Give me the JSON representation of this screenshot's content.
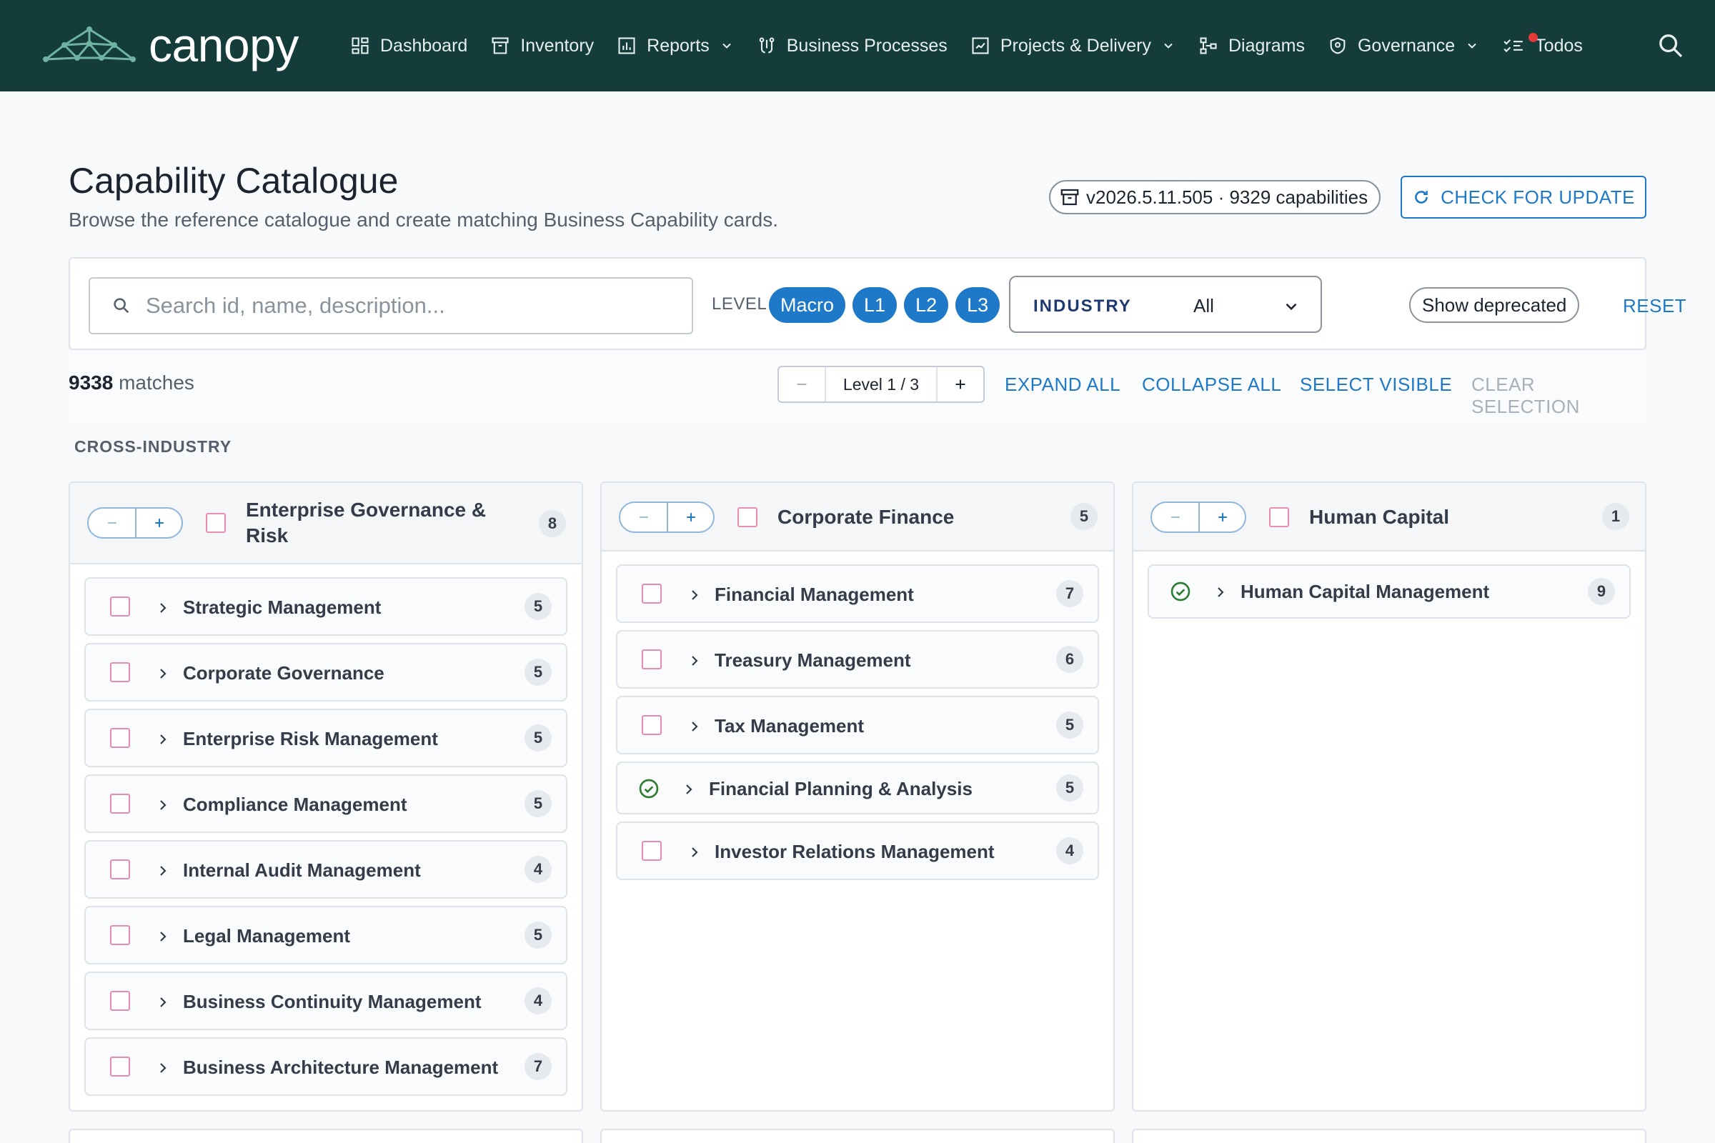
{
  "nav": {
    "brand": "canopy",
    "items": [
      {
        "label": "Dashboard",
        "icon": "dashboard-icon"
      },
      {
        "label": "Inventory",
        "icon": "archive-icon"
      },
      {
        "label": "Reports",
        "icon": "bar-chart-icon",
        "dropdown": true
      },
      {
        "label": "Business Processes",
        "icon": "process-icon"
      },
      {
        "label": "Projects & Delivery",
        "icon": "projects-icon",
        "dropdown": true
      },
      {
        "label": "Diagrams",
        "icon": "diagram-icon"
      },
      {
        "label": "Governance",
        "icon": "shield-icon",
        "dropdown": true
      },
      {
        "label": "Todos",
        "icon": "checklist-icon"
      }
    ]
  },
  "header": {
    "title": "Capability Catalogue",
    "subtitle": "Browse the reference catalogue and create matching Business Capability cards.",
    "version": "v2026.5.11.505 · 9329 capabilities",
    "check_update": "CHECK FOR UPDATE"
  },
  "filters": {
    "search_placeholder": "Search id, name, description...",
    "level_label": "LEVEL",
    "levels": [
      "Macro",
      "L1",
      "L2",
      "L3"
    ],
    "industry_label": "INDUSTRY",
    "industry_value": "All",
    "show_deprecated": "Show deprecated",
    "reset": "RESET"
  },
  "toolbar": {
    "match_count": "9338",
    "match_suffix": " matches",
    "level_indicator": "Level 1 / 3",
    "expand_all": "EXPAND ALL",
    "collapse_all": "COLLAPSE ALL",
    "select_visible": "SELECT VISIBLE",
    "clear_selection": "CLEAR SELECTION"
  },
  "section": {
    "title": "CROSS-INDUSTRY"
  },
  "columns": [
    {
      "title": "Enterprise Governance & Risk",
      "count": "8",
      "items": [
        {
          "label": "Strategic Management",
          "count": "5",
          "selected": false
        },
        {
          "label": "Corporate Governance",
          "count": "5",
          "selected": false
        },
        {
          "label": "Enterprise Risk Management",
          "count": "5",
          "selected": false
        },
        {
          "label": "Compliance Management",
          "count": "5",
          "selected": false
        },
        {
          "label": "Internal Audit Management",
          "count": "4",
          "selected": false
        },
        {
          "label": "Legal Management",
          "count": "5",
          "selected": false
        },
        {
          "label": "Business Continuity Management",
          "count": "4",
          "selected": false
        },
        {
          "label": "Business Architecture Management",
          "count": "7",
          "selected": false
        }
      ]
    },
    {
      "title": "Corporate Finance",
      "count": "5",
      "items": [
        {
          "label": "Financial Management",
          "count": "7",
          "selected": false
        },
        {
          "label": "Treasury Management",
          "count": "6",
          "selected": false
        },
        {
          "label": "Tax Management",
          "count": "5",
          "selected": false
        },
        {
          "label": "Financial Planning & Analysis",
          "count": "5",
          "selected": true
        },
        {
          "label": "Investor Relations Management",
          "count": "4",
          "selected": false
        }
      ]
    },
    {
      "title": "Human Capital",
      "count": "1",
      "items": [
        {
          "label": "Human Capital Management",
          "count": "9",
          "selected": true
        }
      ]
    }
  ],
  "colors": {
    "nav_bg": "#133c3a",
    "accent": "#1e7ac9",
    "checkbox_border": "#e98bb0",
    "success": "#2e7d32"
  }
}
